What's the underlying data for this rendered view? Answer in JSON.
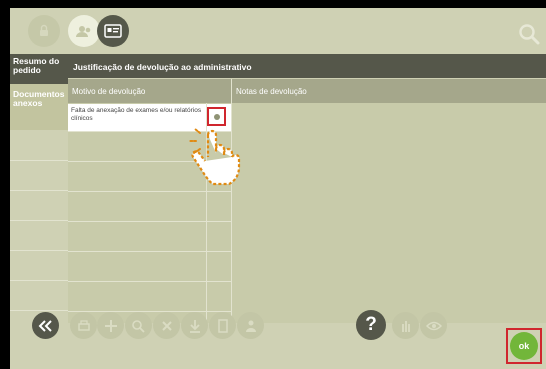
{
  "nav": {
    "resumo": "Resumo do\npedido",
    "documentos": "Documentos\nanexos"
  },
  "panel": {
    "title": "Justificação de devolução ao administrativo",
    "col_motivo": "Motivo de devolução",
    "col_notas": "Notas de devolução",
    "row1_text": "Falta de anexação de exames e/ou relatórios clínicos"
  },
  "footer": {
    "help_label": "?",
    "ok_label": "ok"
  },
  "colors": {
    "screen_bg": "#cfd1b4",
    "header_dark": "#55574a",
    "column_header": "#a5a78b",
    "highlight_red": "#d0262e",
    "ok_green": "#72b63a"
  }
}
